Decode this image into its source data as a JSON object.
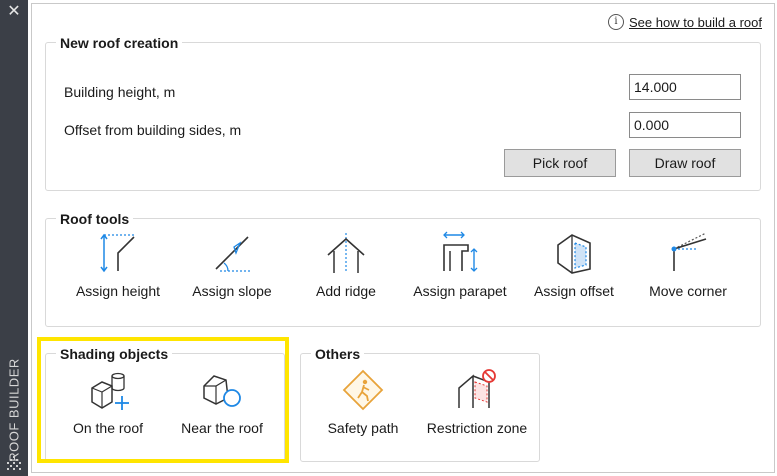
{
  "sidebar": {
    "close_glyph": "✕",
    "title": "ROOF BUILDER"
  },
  "help": {
    "icon": "info-icon",
    "link_text": "See how to build a roof"
  },
  "new_roof": {
    "title": "New roof creation",
    "building_height_label": "Building height, m",
    "building_height_value": "14.000",
    "offset_label": "Offset from building sides, m",
    "offset_value": "0.000",
    "pick_roof_label": "Pick roof",
    "draw_roof_label": "Draw roof"
  },
  "roof_tools": {
    "title": "Roof tools",
    "items": [
      {
        "label": "Assign height",
        "icon": "assign-height-icon"
      },
      {
        "label": "Assign slope",
        "icon": "assign-slope-icon"
      },
      {
        "label": "Add ridge",
        "icon": "add-ridge-icon"
      },
      {
        "label": "Assign parapet",
        "icon": "assign-parapet-icon"
      },
      {
        "label": "Assign offset",
        "icon": "assign-offset-icon"
      },
      {
        "label": "Move corner",
        "icon": "move-corner-icon"
      }
    ]
  },
  "shading": {
    "title": "Shading objects",
    "items": [
      {
        "label": "On the roof",
        "icon": "on-the-roof-icon"
      },
      {
        "label": "Near the roof",
        "icon": "near-the-roof-icon"
      }
    ]
  },
  "others": {
    "title": "Others",
    "items": [
      {
        "label": "Safety path",
        "icon": "safety-path-icon"
      },
      {
        "label": "Restriction zone",
        "icon": "restriction-zone-icon"
      }
    ]
  },
  "colors": {
    "accent_blue": "#1e88e5",
    "highlight_yellow": "#ffe500",
    "warning_orange": "#e8a33a",
    "restriction_red": "#e53935",
    "sidebar_bg": "#3b3f47"
  }
}
